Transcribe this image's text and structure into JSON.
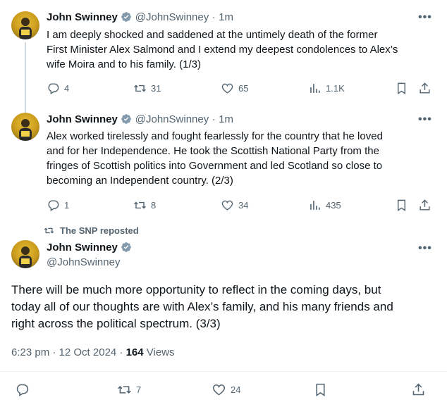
{
  "tweets": [
    {
      "name": "John Swinney",
      "handle": "@JohnSwinney",
      "time": "1m",
      "text_lines": [
        "I am deeply shocked and saddened at the untimely death of the former",
        "First Minister Alex Salmond and I extend my deepest condolences to Alex’s",
        "wife Moira and to his family. (1/3)"
      ],
      "replies": "4",
      "reposts": "31",
      "likes": "65",
      "views": "1.1K"
    },
    {
      "name": "John Swinney",
      "handle": "@JohnSwinney",
      "time": "1m",
      "text_lines": [
        "Alex worked tirelessly and fought fearlessly for the country that he loved",
        "and for her Independence. He took the Scottish National Party from the",
        "fringes of Scottish politics into Government and led Scotland so close to",
        "becoming an Independent country. (2/3)"
      ],
      "replies": "1",
      "reposts": "8",
      "likes": "34",
      "views": "435"
    }
  ],
  "main_tweet": {
    "repost_label": "The SNP reposted",
    "name": "John Swinney",
    "handle": "@JohnSwinney",
    "text_lines": [
      "There will be much more opportunity to reflect in the coming days, but",
      "today all of our thoughts are with Alex’s family, and his many friends and",
      "right across the political spectrum. (3/3)"
    ],
    "timestamp": "6:23 pm · 12 Oct 2024 · ",
    "views_count": "164",
    "views_label": " Views",
    "reposts_partial": "7",
    "likes_partial": "24"
  },
  "colors": {
    "text": "#0f1419",
    "secondary": "#536471",
    "verified": "#829aab",
    "thread_line": "#cfd9de"
  },
  "icons": [
    "reply-icon",
    "repost-icon",
    "like-icon",
    "views-icon",
    "bookmark-icon",
    "share-icon",
    "more-icon",
    "verified-icon"
  ]
}
